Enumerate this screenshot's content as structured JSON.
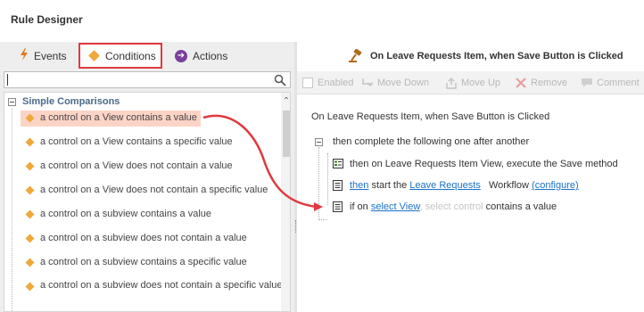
{
  "window": {
    "title": "Rule Designer"
  },
  "tabs": {
    "events": "Events",
    "conditions": "Conditions",
    "actions": "Actions"
  },
  "search": {
    "value": "",
    "placeholder": ""
  },
  "conditions_list": {
    "group_label": "Simple Comparisons",
    "items": [
      "a control on a View contains a value",
      "a control on a View contains a specific value",
      "a control on a View does not contain a value",
      "a control on a View does not contain a specific value",
      "a control on a subview contains a value",
      "a control on a subview does not contain a value",
      "a control on a subview contains a specific value",
      "a control on a subview does not contain a specific value"
    ]
  },
  "rule": {
    "title": "On Leave Requests Item, when Save Button is Clicked",
    "toolbar": {
      "enabled": "Enabled",
      "move_down": "Move Down",
      "move_up": "Move Up",
      "remove": "Remove",
      "comment": "Comment"
    },
    "event_line": "On Leave Requests Item, when Save Button is Clicked",
    "group_line": "then complete the following one after another",
    "action1": "then on Leave Requests Item View, execute the Save method",
    "action2": {
      "then": "then",
      "start": "start the",
      "workflow_link": "Leave Requests",
      "workflow": "Workflow",
      "configure": "(configure)"
    },
    "condition": {
      "if_on": "if on",
      "select_view": "select View",
      "select_control": ", select control",
      "contains": "contains a value"
    }
  },
  "colors": {
    "accent_red": "#e0393e",
    "diamond": "#f0a83a",
    "link": "#1a73c8",
    "selected_bg": "#fcd4c6",
    "actions_icon": "#7a3f9d"
  }
}
